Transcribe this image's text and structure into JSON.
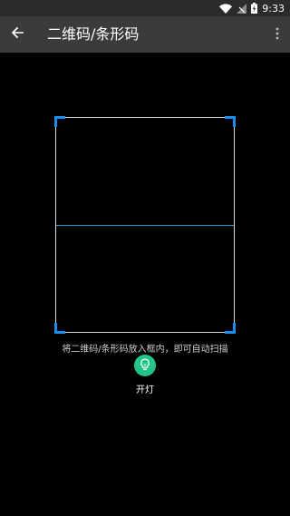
{
  "status_bar": {
    "time": "9:33",
    "icons": [
      "wifi-icon",
      "no-signal-icon",
      "battery-charging-icon"
    ]
  },
  "toolbar": {
    "back_icon": "arrow-left-icon",
    "title": "二维码/条形码",
    "more_icon": "more-vert-icon"
  },
  "scanner": {
    "hint": "将二维码/条形码放入框内，即可自动扫描",
    "accent_color": "#1b8ff0",
    "scan_line_color": "#1ea0c8"
  },
  "flashlight": {
    "icon": "lightbulb-icon",
    "label": "开灯",
    "color": "#22c488"
  }
}
